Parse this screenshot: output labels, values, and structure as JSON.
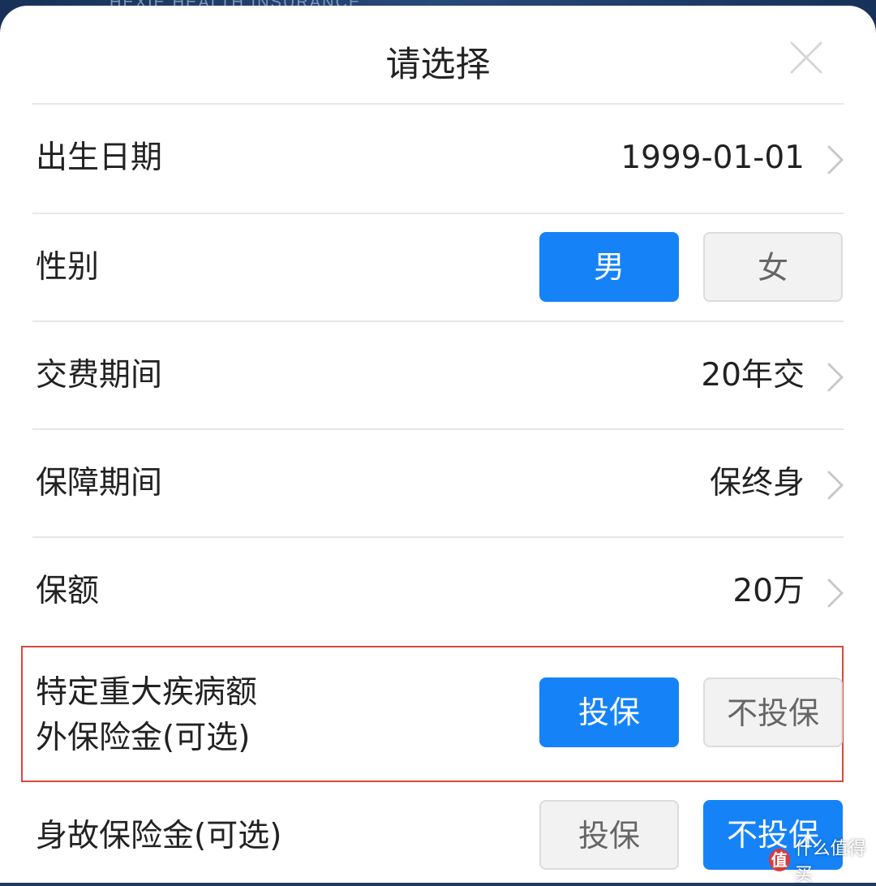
{
  "backdrop": {
    "brand_text": "HEXIE HEALTH INSURANCE"
  },
  "dialog": {
    "title": "请选择",
    "close_icon": "close-icon"
  },
  "rows": {
    "birth": {
      "label": "出生日期",
      "value": "1999-01-01"
    },
    "gender": {
      "label": "性别",
      "options": [
        "男",
        "女"
      ],
      "selected": "男"
    },
    "payment_period": {
      "label": "交费期间",
      "value": "20年交"
    },
    "coverage_period": {
      "label": "保障期间",
      "value": "保终身"
    },
    "sum_insured": {
      "label": "保额",
      "value": "20万"
    },
    "extra_ci": {
      "label_line1": "特定重大疾病额",
      "label_line2": "外保险金(可选)",
      "options": [
        "投保",
        "不投保"
      ],
      "selected": "投保"
    },
    "death_benefit": {
      "label": "身故保险金(可选)",
      "options": [
        "投保",
        "不投保"
      ],
      "selected": "不投保"
    }
  },
  "colors": {
    "accent": "#1583f7",
    "highlight_border": "#d9483b"
  },
  "watermark": {
    "badge": "值",
    "text": "什么值得买"
  }
}
